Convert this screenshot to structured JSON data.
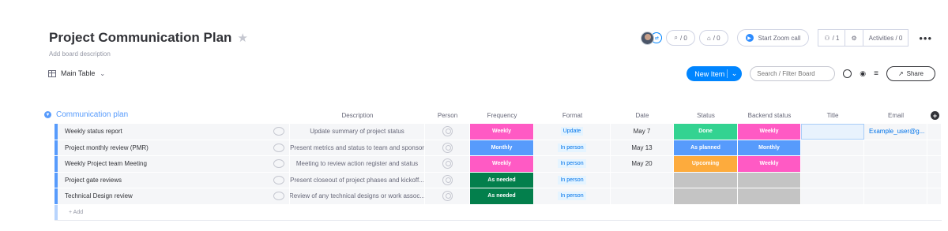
{
  "header": {
    "title": "Project Communication Plan",
    "description_placeholder": "Add board description",
    "updates_count": "/ 0",
    "inbox_count": "/ 0",
    "zoom_label": "Start Zoom call",
    "members_count": "/ 1",
    "activities_label": "Activities / 0"
  },
  "toolbar": {
    "view_label": "Main Table",
    "new_item_label": "New Item",
    "search_placeholder": "Search / Filter Board",
    "share_label": "Share"
  },
  "group": {
    "name": "Communication plan",
    "add_label": "+ Add"
  },
  "columns": {
    "description": "Description",
    "person": "Person",
    "frequency": "Frequency",
    "format": "Format",
    "date": "Date",
    "status": "Status",
    "backend_status": "Backend status",
    "title": "Title",
    "email": "Email"
  },
  "colors": {
    "weekly": "#ff5ac4",
    "monthly": "#579bfc",
    "as_needed": "#037f4c",
    "done": "#33d391",
    "as_planned": "#579bfc",
    "upcoming": "#fdab3d",
    "empty": "#c4c4c4"
  },
  "rows": [
    {
      "name": "Weekly status report",
      "description": "Update summary of project status",
      "frequency": "Weekly",
      "format": "Update",
      "date": "May 7",
      "status": "Done",
      "backend": "Weekly",
      "email": "Example_user@g..."
    },
    {
      "name": "Project monthly review (PMR)",
      "description": "Present metrics and status to team and sponsor",
      "frequency": "Monthly",
      "format": "In person",
      "date": "May 13",
      "status": "As planned",
      "backend": "Monthly",
      "email": ""
    },
    {
      "name": "Weekly Project team Meeting",
      "description": "Meeting to review action register and status",
      "frequency": "Weekly",
      "format": "In person",
      "date": "May 20",
      "status": "Upcoming",
      "backend": "Weekly",
      "email": ""
    },
    {
      "name": "Project gate reviews",
      "description": "Present closeout of project phases and kickoff...",
      "frequency": "As needed",
      "format": "In person",
      "date": "",
      "status": "",
      "backend": "",
      "email": ""
    },
    {
      "name": "Technical Design review",
      "description": "Review of any technical designs or work assoc...",
      "frequency": "As needed",
      "format": "In person",
      "date": "",
      "status": "",
      "backend": "",
      "email": ""
    }
  ]
}
